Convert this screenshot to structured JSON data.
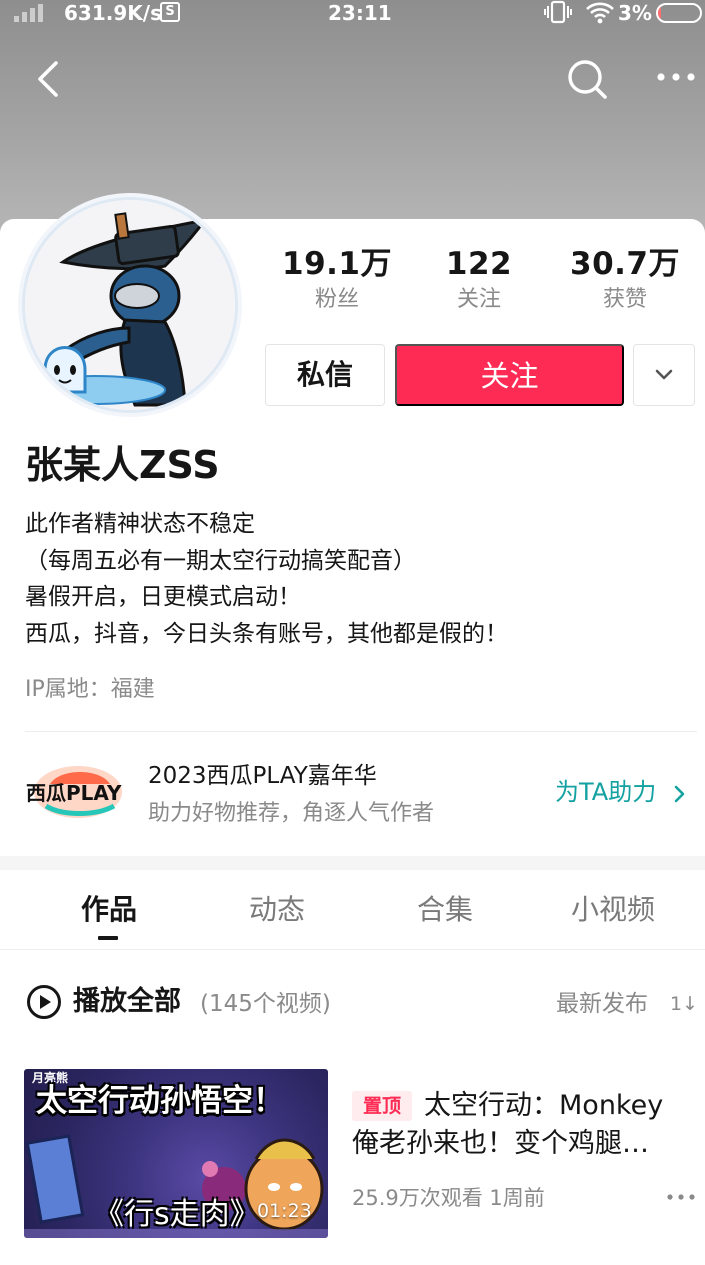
{
  "status_bar": {
    "speed": "631.9K/s",
    "s_badge": "S",
    "time": "23:11",
    "battery_pct": "3%",
    "battery_level": 0.03,
    "battery_color": "#ff6f6f"
  },
  "nav": {
    "back_icon": "chevron-left",
    "search_icon": "search",
    "more_icon": "ellipsis"
  },
  "profile": {
    "stats": [
      {
        "value": "19.1万",
        "label": "粉丝"
      },
      {
        "value": "122",
        "label": "关注"
      },
      {
        "value": "30.7万",
        "label": "获赞"
      }
    ],
    "message_label": "私信",
    "follow_label": "关注",
    "follow_color": "#fe2c55",
    "name": "张某人ZSS",
    "bio": [
      "此作者精神状态不稳定",
      "（每周五必有一期太空行动搞笑配音）",
      "暑假开启，日更模式启动！",
      "西瓜，抖音，今日头条有账号，其他都是假的！"
    ],
    "ip_location": "IP属地：福建"
  },
  "promo": {
    "logo_text": "西瓜PLAY",
    "title": "2023西瓜PLAY嘉年华",
    "subtitle": "助力好物推荐，角逐人气作者",
    "cta": "为TA助力",
    "cta_color": "#14a1a1"
  },
  "tabs": [
    "作品",
    "动态",
    "合集",
    "小视频"
  ],
  "active_tab": 0,
  "list_header": {
    "play_all": "播放全部",
    "count": "(145个视频)",
    "sort": "最新发布",
    "sort_icon": "1↓"
  },
  "videos": [
    {
      "thumb_channel": "月亮熊",
      "thumb_title": "太空行动孙悟空！",
      "thumb_subtitle": "《行s走肉》",
      "duration": "01:23",
      "pinned_label": "置顶",
      "title_line1": "太空行动：Monkey",
      "title_line2": "俺老孙来也！变个鸡腿…",
      "meta": "25.9万次观看  1周前"
    }
  ]
}
